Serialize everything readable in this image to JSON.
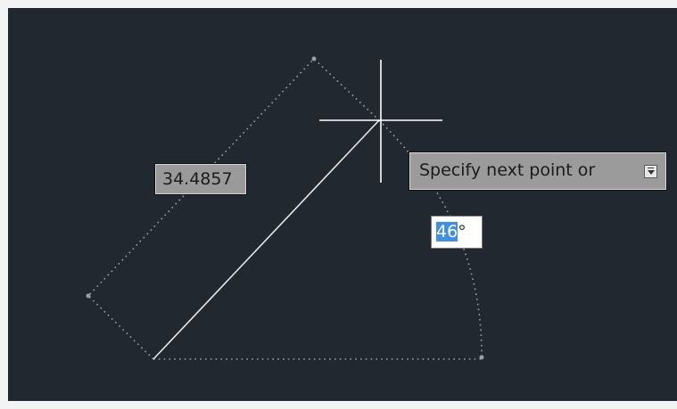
{
  "dimension": {
    "length_value": "34.4857"
  },
  "prompt": {
    "text": "Specify next point or",
    "dropdown_icon": "dropdown-arrow-icon"
  },
  "angle": {
    "value": "46",
    "unit": "°"
  },
  "colors": {
    "canvas_bg": "#212830",
    "line": "#e6e6e6",
    "tooltip_bg": "#9b9b9b",
    "angle_highlight": "#3f8ee8"
  }
}
